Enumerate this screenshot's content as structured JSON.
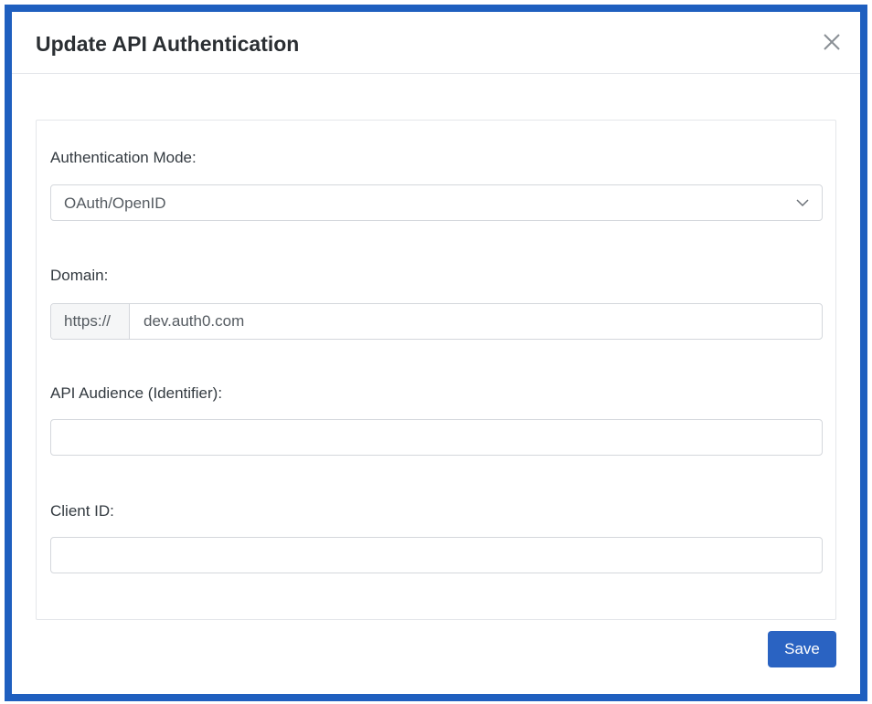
{
  "modal": {
    "title": "Update API Authentication",
    "close_icon": "close-icon"
  },
  "form": {
    "auth_mode": {
      "label": "Authentication Mode:",
      "selected": "OAuth/OpenID",
      "icon": "chevron-down-icon"
    },
    "domain": {
      "label": "Domain:",
      "prefix": "https://",
      "value": "dev.auth0.com"
    },
    "audience": {
      "label": "API Audience (Identifier):",
      "value": ""
    },
    "client_id": {
      "label": "Client ID:",
      "value": ""
    }
  },
  "footer": {
    "save_label": "Save"
  },
  "colors": {
    "frame_border": "#1f5fbf",
    "primary_button": "#2a63c2"
  }
}
